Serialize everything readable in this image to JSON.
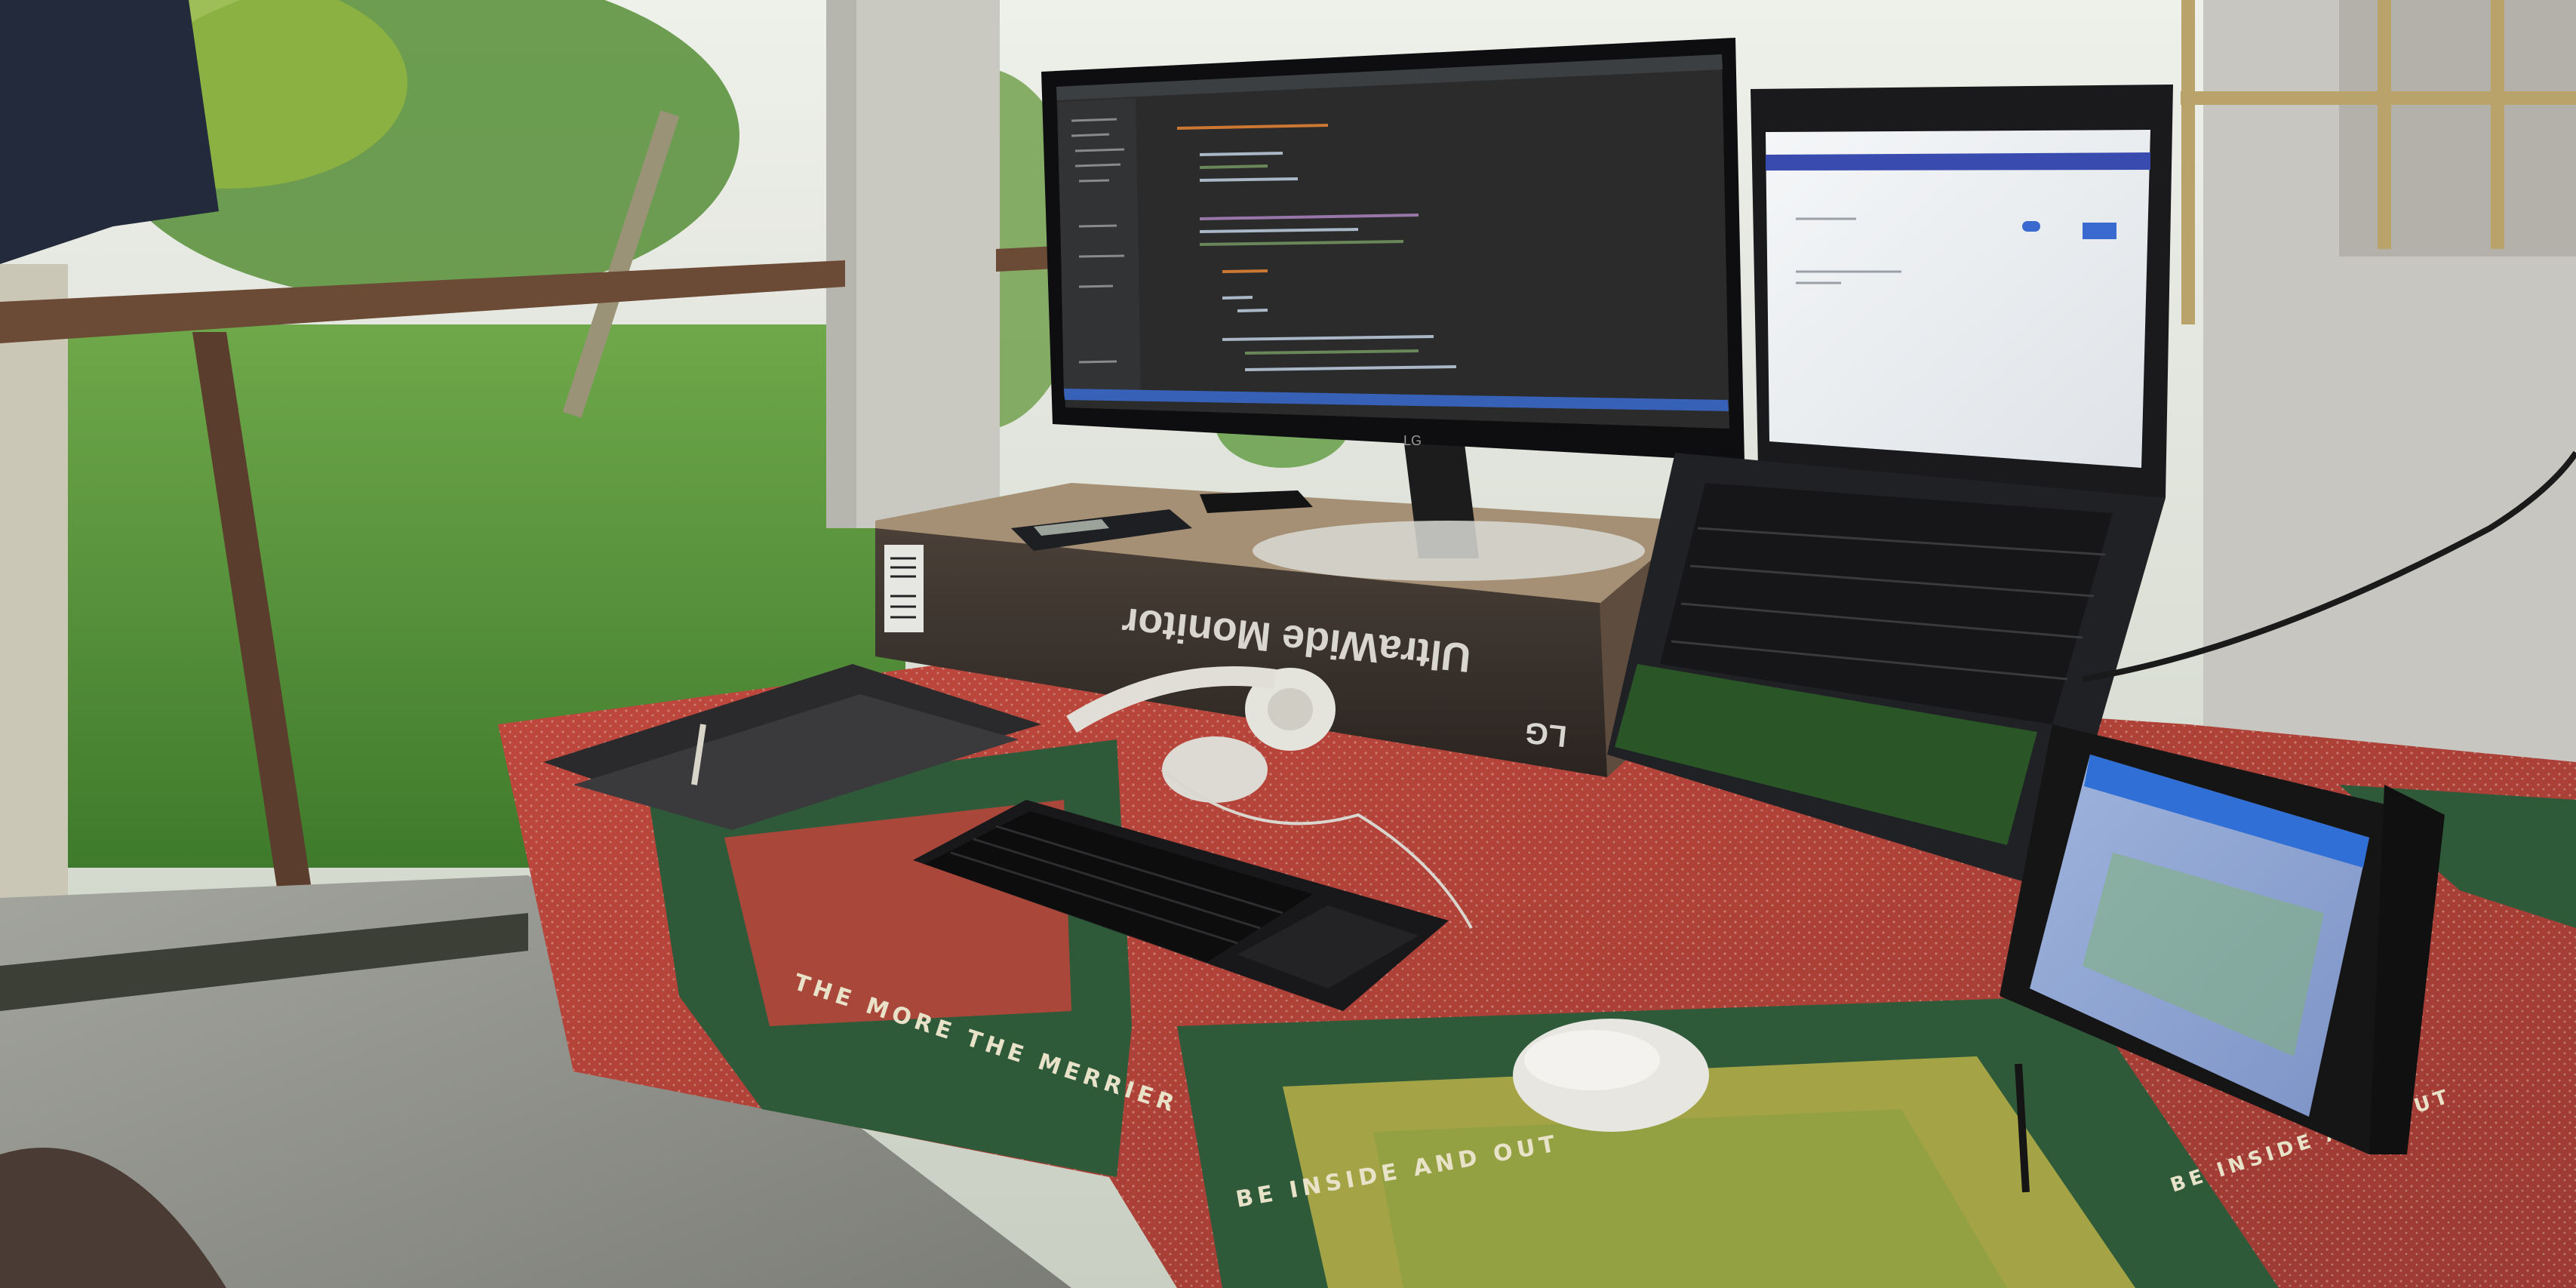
{
  "scene": {
    "monitor_box_text": "UltraWide Monitor",
    "monitor_box_brand": "LG",
    "monitor_brand": "LG",
    "tablecloth_text": [
      "THE MORE THE MERRIER",
      "BE INSIDE AND OUT",
      "BE INSIDE AND OUT"
    ]
  },
  "colors": {
    "ide_background": "#2b2b2b",
    "tablecloth_red": "#b8453c",
    "tablecloth_green": "#2f5a3a",
    "foliage": "#4f8a3a",
    "tablet_header": "#2f6fd6"
  },
  "objects": [
    {
      "name": "ultrawide-monitor",
      "icon": "monitor-icon"
    },
    {
      "name": "laptop",
      "icon": "laptop-icon"
    },
    {
      "name": "tablet",
      "icon": "tablet-icon"
    },
    {
      "name": "wireless-keyboard",
      "icon": "keyboard-icon"
    },
    {
      "name": "mouse",
      "icon": "mouse-icon"
    },
    {
      "name": "headphones",
      "icon": "headphones-icon"
    },
    {
      "name": "calculator",
      "icon": "calculator-icon"
    },
    {
      "name": "notebook",
      "icon": "notebook-icon"
    },
    {
      "name": "pen",
      "icon": "pen-icon"
    }
  ]
}
